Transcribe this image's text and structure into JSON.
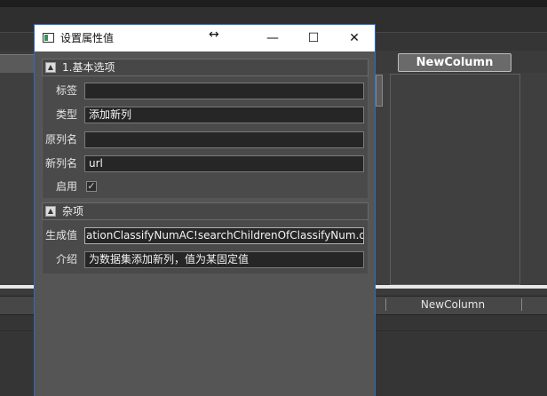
{
  "background": {
    "column_button_label": "NewColumn",
    "header_column_label": "NewColumn"
  },
  "dialog": {
    "title": "设置属性值",
    "resize_glyph": "↔",
    "minimize_glyph": "—",
    "maximize_glyph": "☐",
    "close_glyph": "✕",
    "sections": {
      "basic": {
        "toggle_glyph": "▲",
        "label": "1.基本选项",
        "props": {
          "tag": {
            "label": "标签",
            "value": ""
          },
          "type": {
            "label": "类型",
            "value": "添加新列"
          },
          "original_name": {
            "label": "原列名",
            "value": ""
          },
          "new_name": {
            "label": "新列名",
            "value": "url"
          },
          "enabled": {
            "label": "启用",
            "checked": true,
            "check_glyph": "✓"
          }
        }
      },
      "misc": {
        "toggle_glyph": "▲",
        "label": "杂项",
        "props": {
          "generated_value": {
            "label": "生成值",
            "value": "ationClassifyNumAC!searchChildrenOfClassifyNum.do"
          },
          "description": {
            "label": "介绍",
            "value": "为数据集添加新列，值为某固定值"
          }
        }
      }
    }
  }
}
